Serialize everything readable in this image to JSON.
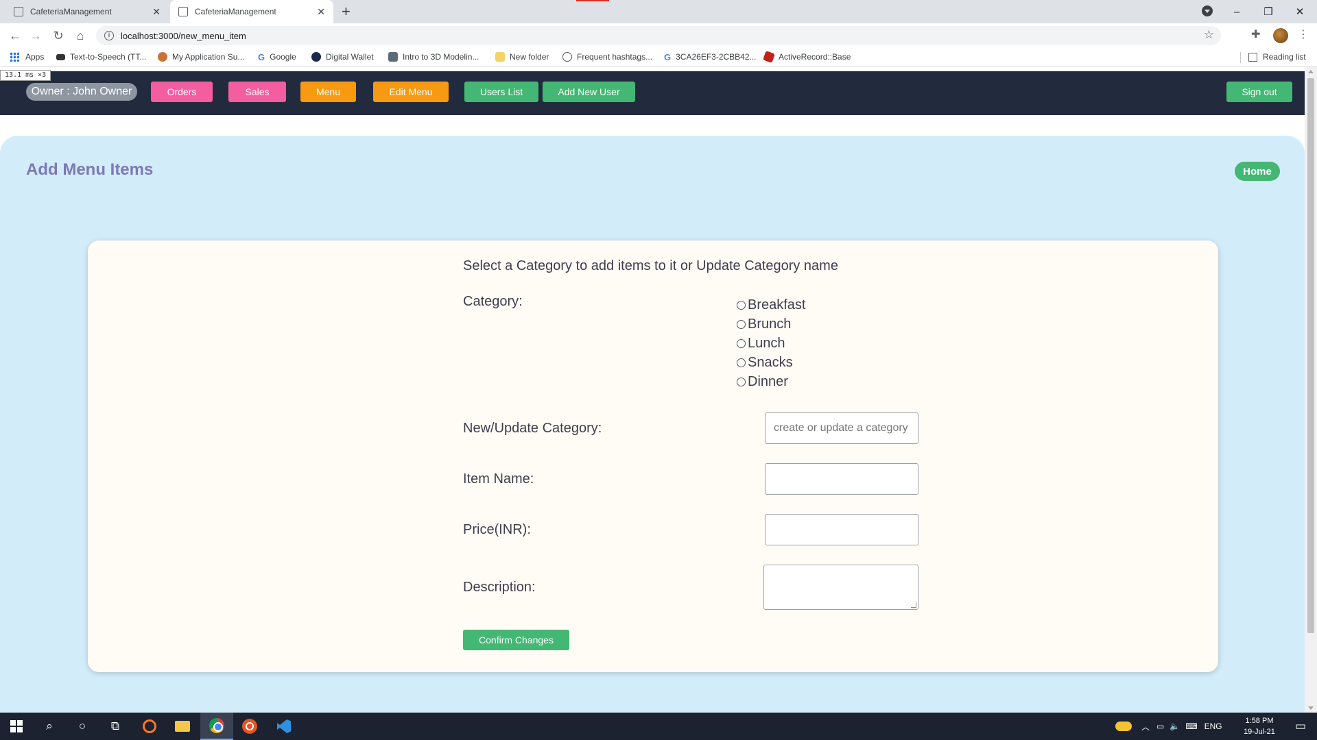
{
  "browser": {
    "tabs": [
      {
        "title": "CafeteriaManagement",
        "active": false
      },
      {
        "title": "CafeteriaManagement",
        "active": true
      }
    ],
    "url": "localhost:3000/new_menu_item",
    "bookmarks": [
      {
        "label": "Apps",
        "icon": "apps-grid-icon"
      },
      {
        "label": "Text-to-Speech (TT...",
        "icon": "speech-icon"
      },
      {
        "label": "My Application Su...",
        "icon": "face-icon"
      },
      {
        "label": "Google",
        "icon": "google-icon"
      },
      {
        "label": "Digital Wallet",
        "icon": "wallet-icon"
      },
      {
        "label": "Intro to 3D Modelin...",
        "icon": "image-icon"
      },
      {
        "label": "New folder",
        "icon": "folder-icon"
      },
      {
        "label": "Frequent hashtags...",
        "icon": "globe-icon"
      },
      {
        "label": "3CA26EF3-2CBB42...",
        "icon": "google-icon"
      },
      {
        "label": "ActiveRecord::Base",
        "icon": "ruby-icon"
      }
    ],
    "reading_list": "Reading list"
  },
  "perf_badge": "13.1 ms ×3",
  "navbar": {
    "owner": "Owner : John Owner",
    "buttons": [
      {
        "label": "Orders",
        "color": "#f25ea0"
      },
      {
        "label": "Sales",
        "color": "#f25ea0"
      },
      {
        "label": "Menu",
        "color": "#f79a12"
      },
      {
        "label": "Edit Menu",
        "color": "#f79a12"
      },
      {
        "label": "Users List",
        "color": "#44b774"
      },
      {
        "label": "Add New User",
        "color": "#44b774"
      }
    ],
    "sign_out": "Sign out"
  },
  "page": {
    "title": "Add Menu Items",
    "home_button": "Home",
    "instruction": "Select a Category to add items to it or Update Category name",
    "category_label": "Category:",
    "categories": [
      "Breakfast",
      "Brunch",
      "Lunch",
      "Snacks",
      "Dinner"
    ],
    "new_category_label": "New/Update Category:",
    "new_category_placeholder": "create or update a category",
    "item_name_label": "Item Name:",
    "price_label": "Price(INR):",
    "description_label": "Description:",
    "confirm_button": "Confirm Changes"
  },
  "taskbar": {
    "language": "ENG",
    "time": "1:58 PM",
    "date": "19-Jul-21"
  },
  "colors": {
    "navbar_bg": "#222a3e",
    "panel_bg": "#d3ecfa",
    "card_bg": "#fffcf5",
    "title_color": "#7d79b5",
    "accent_green": "#44b774",
    "accent_pink": "#f25ea0",
    "accent_orange": "#f79a12"
  }
}
